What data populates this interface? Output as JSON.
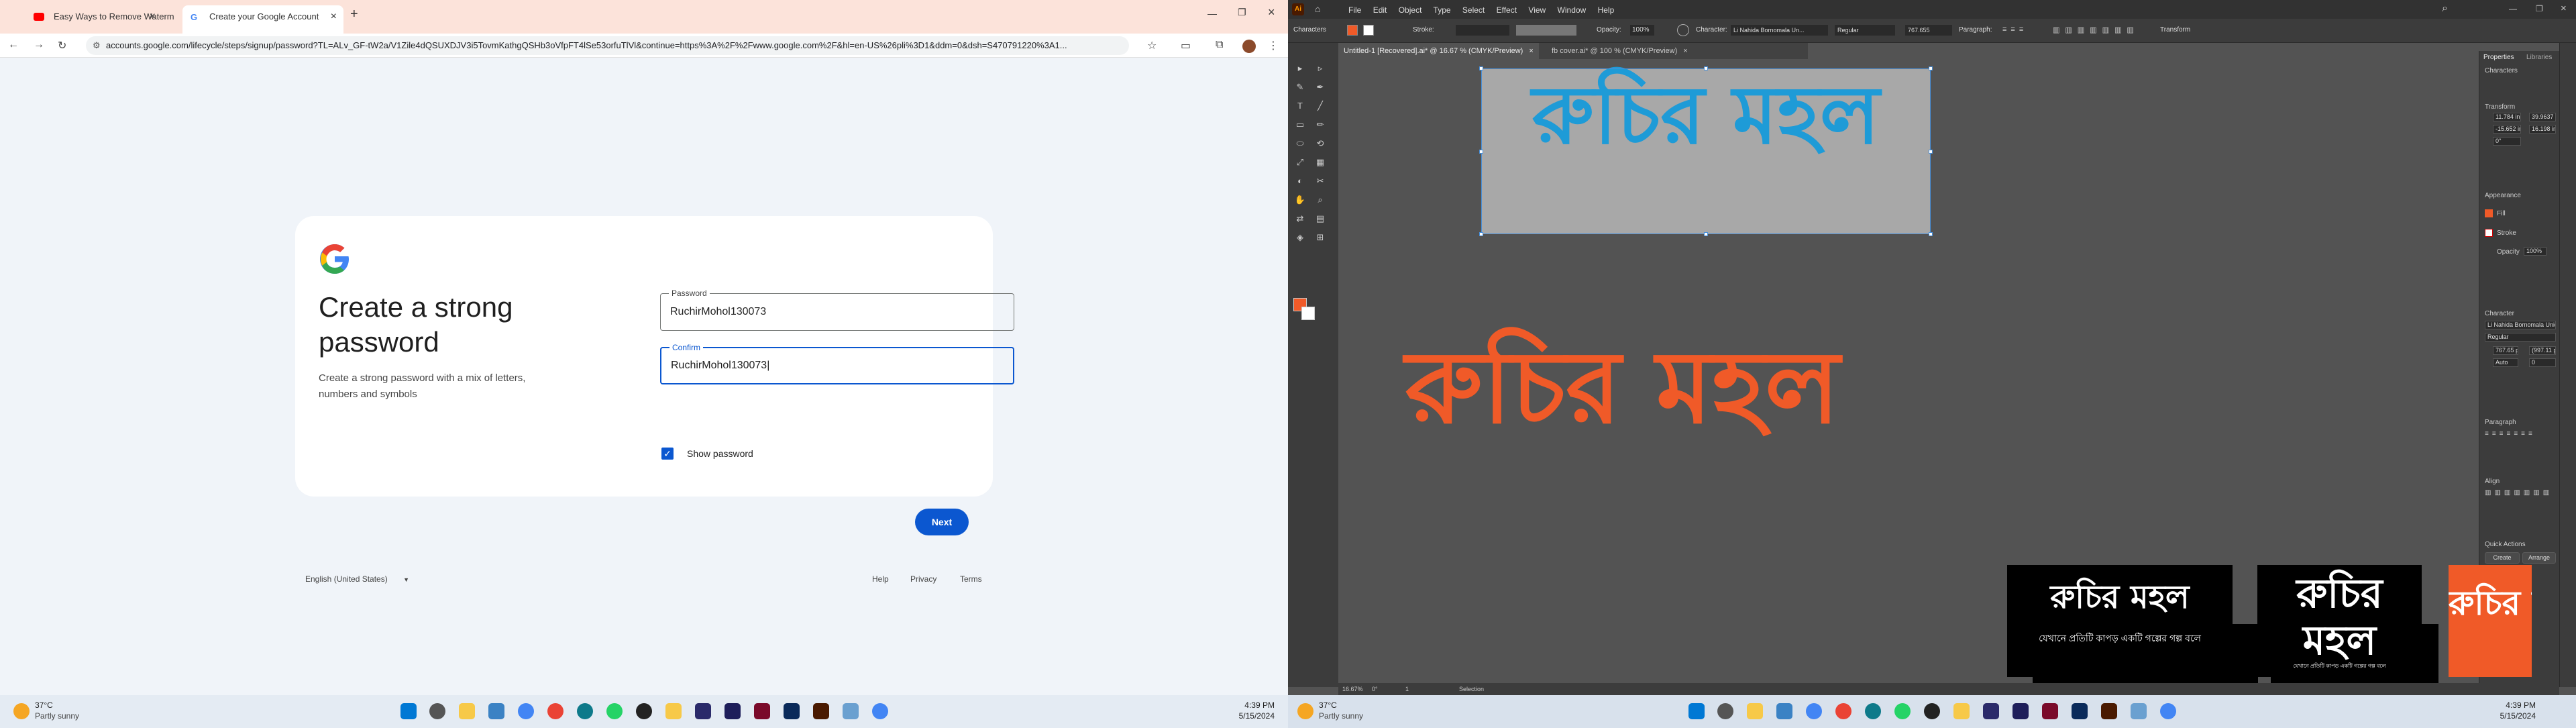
{
  "browser": {
    "tabs": [
      {
        "label": "Easy Ways to Remove Waterm",
        "icon": "youtube-icon",
        "active": false
      },
      {
        "label": "Create your Google Account",
        "icon": "google-icon",
        "active": true
      }
    ],
    "new_tab_label": "+",
    "url": "accounts.google.com/lifecycle/steps/signup/password?TL=ALv_GF-tW2a/V1Zile4dQSUXDJV3i5TovmKathgQSHb3oVfpFT4lSe53orfuTlVl&continue=https%3A%2F%2Fwww.google.com%2F&hl=en-US%26pli%3D1&ddm=0&dsh=S470791220%3A1..."
  },
  "signup": {
    "title": "Create a strong password",
    "description": "Create a strong password with a mix of letters, numbers and symbols",
    "password_label": "Password",
    "password_value": "RuchirMohol130073",
    "confirm_label": "Confirm",
    "confirm_value": "RuchirMohol130073",
    "show_password_label": "Show password",
    "show_password_checked": true,
    "next_label": "Next",
    "language": "English (United States)",
    "footer_links": [
      "Help",
      "Privacy",
      "Terms"
    ]
  },
  "taskbar_left": {
    "temp": "37°C",
    "weather": "Partly sunny",
    "time": "4:39 PM",
    "date": "5/15/2024"
  },
  "illustrator": {
    "menu": [
      "File",
      "Edit",
      "Object",
      "Type",
      "Select",
      "Effect",
      "View",
      "Window",
      "Help"
    ],
    "control_bar": {
      "label": "Characters",
      "stroke_label": "Stroke:",
      "opacity_label": "Opacity:",
      "opacity_value": "100%",
      "character_label": "Character:",
      "font": "Li Nahida Bornomala Un...",
      "style": "Regular",
      "size": "767.655",
      "paragraph_label": "Paragraph:",
      "transform_label": "Transform"
    },
    "doc_tabs": [
      {
        "label": "Untitled-1 [Recovered].ai* @ 16.67 % (CMYK/Preview)",
        "active": true
      },
      {
        "label": "fb cover.ai* @ 100 % (CMYK/Preview)",
        "active": false
      }
    ],
    "canvas": {
      "selected_text": "রুচির মহল",
      "orange_text": "রুচির মহল",
      "thumb_subtitle": "যেখানে প্রতিটি কাপড় একটি গল্পের গল্প বলে",
      "thumb_tiny": "যেখানে প্রতিটি কাপড় একটি গল্পের গল্প বলে"
    },
    "panel_tabs": [
      "Properties",
      "Libraries"
    ],
    "properties": {
      "section_characters": "Characters",
      "section_transform": "Transform",
      "x_label": "X:",
      "x_value": "11.784 in",
      "y_label": "Y:",
      "y_value": "-15.652 in",
      "w_label": "W:",
      "w_value": "39.9637 in",
      "h_label": "H:",
      "h_value": "16.198 in",
      "rotate_value": "0°",
      "section_appearance": "Appearance",
      "fill_label": "Fill",
      "stroke_label": "Stroke",
      "opacity_label": "Opacity",
      "opacity_value": "100%",
      "section_character": "Character",
      "font": "Li Nahida Bornomala Unicode",
      "style": "Regular",
      "size_value": "767.65 pt",
      "leading_value": "(997.11 p",
      "tracking_value": "Auto",
      "kerning_value": "0",
      "section_paragraph": "Paragraph",
      "section_align": "Align",
      "section_quick_actions": "Quick Actions",
      "create_outlines": "Create Outlines",
      "arrange": "Arrange"
    },
    "status": {
      "zoom": "16.67%",
      "rotation": "0°",
      "artboard": "1",
      "tool": "Selection"
    },
    "colors": {
      "orange": "#f05a28",
      "blue": "#1e9bd7",
      "selection": "#4a90d9"
    }
  },
  "taskbar_right": {
    "temp": "37°C",
    "weather": "Partly sunny",
    "time": "4:39 PM",
    "date": "5/15/2024"
  }
}
